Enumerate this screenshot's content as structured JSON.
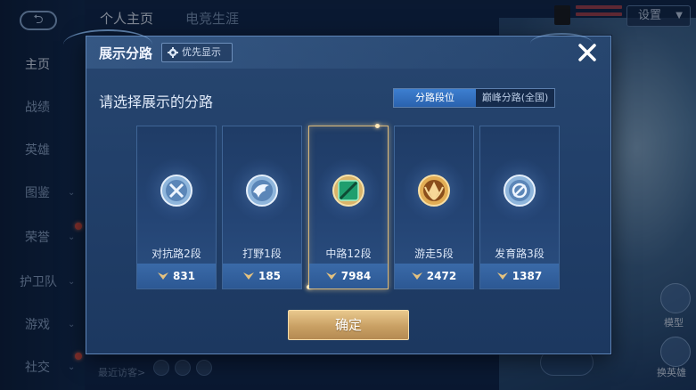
{
  "background": {
    "back_label": "",
    "top_tabs": [
      "个人主页",
      "电竞生涯"
    ],
    "settings_label": "设置",
    "nav_items": [
      "主页",
      "战绩",
      "英雄",
      "图鉴",
      "荣誉",
      "护卫队",
      "游戏",
      "社交"
    ],
    "recent_visitors": "最近访客>",
    "right_labels": [
      "模型",
      "换英雄"
    ]
  },
  "modal": {
    "title": "展示分路",
    "priority_label": "优先显示",
    "subtitle": "请选择展示的分路",
    "toggle": {
      "options": [
        "分路段位",
        "巅峰分路(全国)"
      ],
      "active_index": 0
    },
    "lanes": [
      {
        "label": "对抗路2段",
        "score": "831",
        "emblem": "clash-lane-emblem",
        "color": "#c8dcf0"
      },
      {
        "label": "打野1段",
        "score": "185",
        "emblem": "jungle-emblem",
        "color": "#c8dcf0"
      },
      {
        "label": "中路12段",
        "score": "7984",
        "emblem": "mid-lane-emblem",
        "color": "#34c88a",
        "selected": true
      },
      {
        "label": "游走5段",
        "score": "2472",
        "emblem": "roam-emblem",
        "color": "#e7b25a"
      },
      {
        "label": "发育路3段",
        "score": "1387",
        "emblem": "farm-lane-emblem",
        "color": "#c8dcf0"
      }
    ],
    "confirm_label": "确定"
  },
  "colors": {
    "accent_gold": "#d9b87a",
    "toggle_active": "#3d7fd0",
    "panel": "#22406a"
  }
}
